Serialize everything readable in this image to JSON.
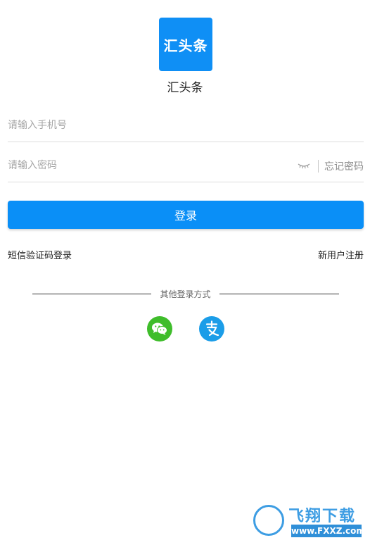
{
  "app": {
    "logo_text": "汇头条",
    "name": "汇头条"
  },
  "login_form": {
    "phone_placeholder": "请输入手机号",
    "password_placeholder": "请输入密码",
    "forgot_password": "忘记密码",
    "submit_label": "登录"
  },
  "links": {
    "sms_login": "短信验证码登录",
    "register": "新用户注册"
  },
  "other_login": {
    "label": "其他登录方式",
    "providers": [
      {
        "name": "wechat",
        "icon": "wechat-icon"
      },
      {
        "name": "alipay",
        "icon": "alipay-icon"
      }
    ]
  },
  "watermark": {
    "title": "飞翔下载",
    "url": "www.FXXZ.com"
  },
  "colors": {
    "brand_blue": "#0a8ff7",
    "wechat_green": "#3fbd2b",
    "alipay_blue": "#1b9de8"
  }
}
